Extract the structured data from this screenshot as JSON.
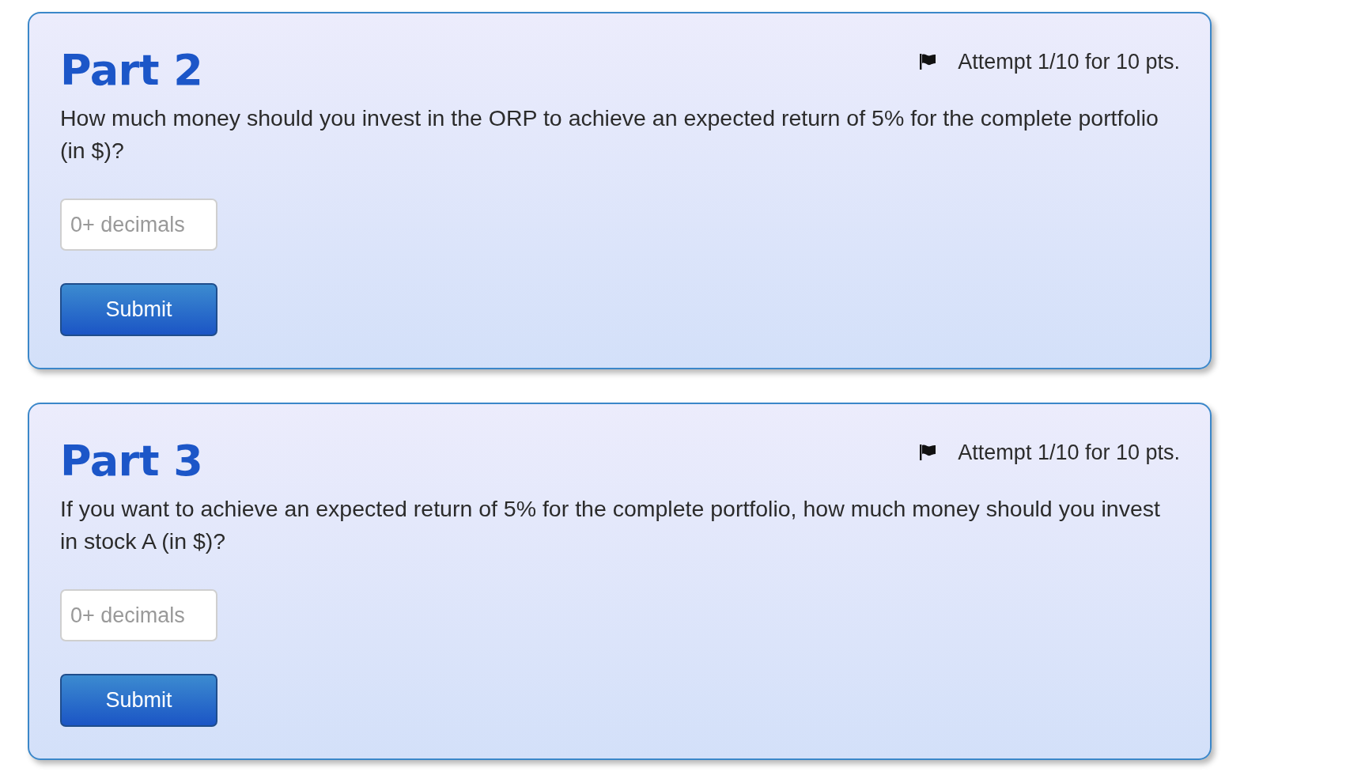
{
  "parts": [
    {
      "title": "Part 2",
      "attempt": "Attempt 1/10 for 10 pts.",
      "question": "How much money should you invest in the ORP to achieve an expected return of 5% for the complete portfolio (in $)?",
      "answer": {
        "placeholder": "0+ decimals"
      },
      "submit": "Submit"
    },
    {
      "title": "Part 3",
      "attempt": "Attempt 1/10 for 10 pts.",
      "question": "If you want to achieve an expected return of 5% for the complete portfolio, how much money should you invest in stock A (in $)?",
      "answer": {
        "placeholder": "0+ decimals"
      },
      "submit": "Submit"
    }
  ]
}
